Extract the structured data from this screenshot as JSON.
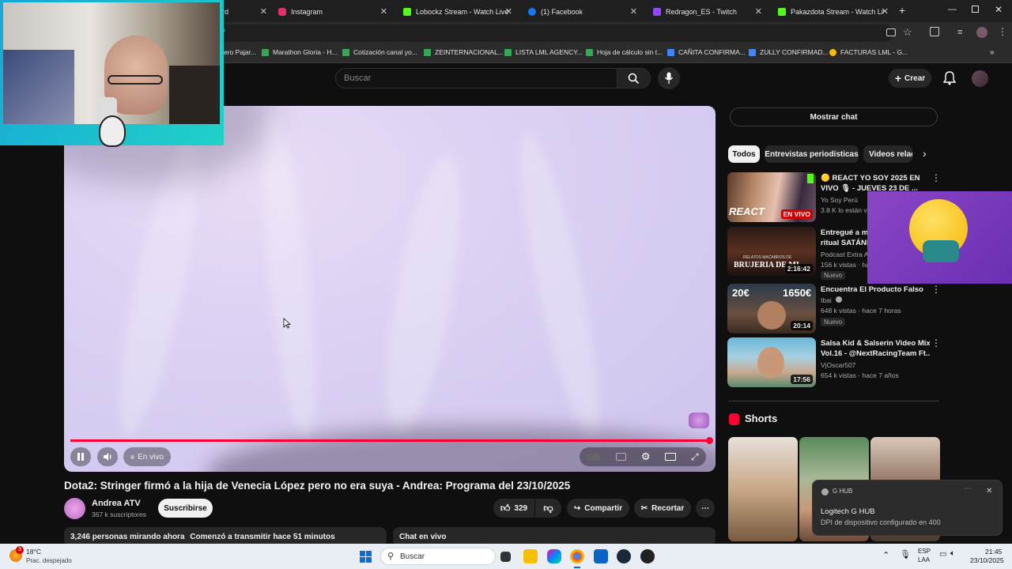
{
  "browser": {
    "tabs": [
      {
        "title": "ard",
        "color": "#4285f4"
      },
      {
        "title": "Instagram",
        "color": "#e1306c"
      },
      {
        "title": "Lobockz Stream - Watch Live o",
        "color": "#53fc18"
      },
      {
        "title": "(1) Facebook",
        "color": "#1877f2"
      },
      {
        "title": "Redragon_ES - Twitch",
        "color": "#9146ff"
      },
      {
        "title": "Pakazdota Stream - Watch Live",
        "color": "#53fc18"
      }
    ],
    "bookmarks": [
      {
        "label": "ero Pajar...",
        "color": "#34a853"
      },
      {
        "label": "Marathon Gloria - H...",
        "color": "#34a853"
      },
      {
        "label": "Cotización canal yo...",
        "color": "#34a853"
      },
      {
        "label": "ZEINTERNACIONAL...",
        "color": "#34a853"
      },
      {
        "label": "LISTA LML AGENCY...",
        "color": "#34a853"
      },
      {
        "label": "Hoja de cálculo sin t...",
        "color": "#34a853"
      },
      {
        "label": "CAÑITA CONFIRMA...",
        "color": "#4285f4"
      },
      {
        "label": "ZULLY CONFIRMAD...",
        "color": "#4285f4"
      },
      {
        "label": "FACTURAS LML - G...",
        "color": "#fbbc04"
      }
    ]
  },
  "youtube": {
    "search_placeholder": "Buscar",
    "create_label": "Crear",
    "video": {
      "title": "Dota2: Stringer firmó a la hija de Venecia López pero no era suya - Andrea: Programa del 23/10/2025",
      "live_label": "En vivo"
    },
    "channel": {
      "name": "Andrea ATV",
      "subscribers": "367 k suscriptores",
      "subscribe_label": "Suscribirse"
    },
    "actions": {
      "likes": "329",
      "share": "Compartir",
      "clip": "Recortar"
    },
    "description": {
      "watching": "3,246 personas mirando ahora",
      "started": "Comenzó a transmitir hace 51 minutos"
    },
    "chat_label": "Chat en vivo",
    "show_chat": "Mostrar chat",
    "chips": [
      "Todos",
      "Entrevistas periodísticas",
      "Videos relac"
    ],
    "recommendations": [
      {
        "title1": "🟡 REACT YO SOY 2025 EN",
        "title2": "VIVO 🎙 - JUEVES 23 DE ...",
        "channel": "Yo Soy Perú",
        "meta": "3.8 K lo están vi",
        "duration": "EN VIVO"
      },
      {
        "title1": "Entregué a mi",
        "title2": "ritual SATÁNIC",
        "channel": "Podcast Extra A",
        "meta": "156 k vistas · ha",
        "duration": "2:16:42",
        "badge": "Nuevo"
      },
      {
        "title1": "Encuentra El Producto Falso",
        "title2": "",
        "channel": "Ibai",
        "meta": "648 k vistas · hace 7 horas",
        "duration": "20:14",
        "badge": "Nuevo"
      },
      {
        "title1": "Salsa Kid & Salserin Video Mix",
        "title2": "Vol.16 - @NextRacingTeam Ft....",
        "channel": "VjOscar507",
        "meta": "654 k vistas · hace 7 años",
        "duration": "17:56"
      }
    ],
    "thumb_text": {
      "react": "REACT",
      "brujeria_top": "RELATOS MACABROS DE",
      "brujeria": "BRUJERIA DE MI",
      "price_left": "20€",
      "price_right": "1650€"
    },
    "shorts_title": "Shorts"
  },
  "toast": {
    "app": "G HUB",
    "title": "Logitech G HUB",
    "message": "DPI de dispositivo configurado en 400"
  },
  "taskbar": {
    "temperature": "18°C",
    "weather": "Prac. despejado",
    "weather_badge": "3",
    "search": "Buscar",
    "lang1": "ESP",
    "lang2": "LAA",
    "time": "21:45",
    "date": "23/10/2025"
  }
}
